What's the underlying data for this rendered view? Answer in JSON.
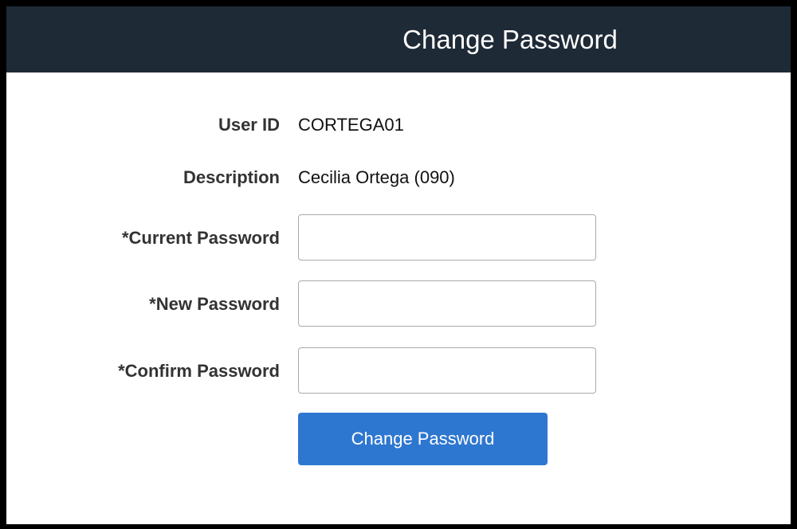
{
  "header": {
    "title": "Change Password"
  },
  "form": {
    "user_id": {
      "label": "User ID",
      "value": "CORTEGA01"
    },
    "description": {
      "label": "Description",
      "value": "Cecilia Ortega (090)"
    },
    "current_password": {
      "label": "*Current Password",
      "value": ""
    },
    "new_password": {
      "label": "*New Password",
      "value": ""
    },
    "confirm_password": {
      "label": "*Confirm Password",
      "value": ""
    },
    "submit_label": "Change Password"
  },
  "colors": {
    "header_bg": "#1f2a37",
    "button_bg": "#2e77d0",
    "frame_border": "#000000"
  }
}
